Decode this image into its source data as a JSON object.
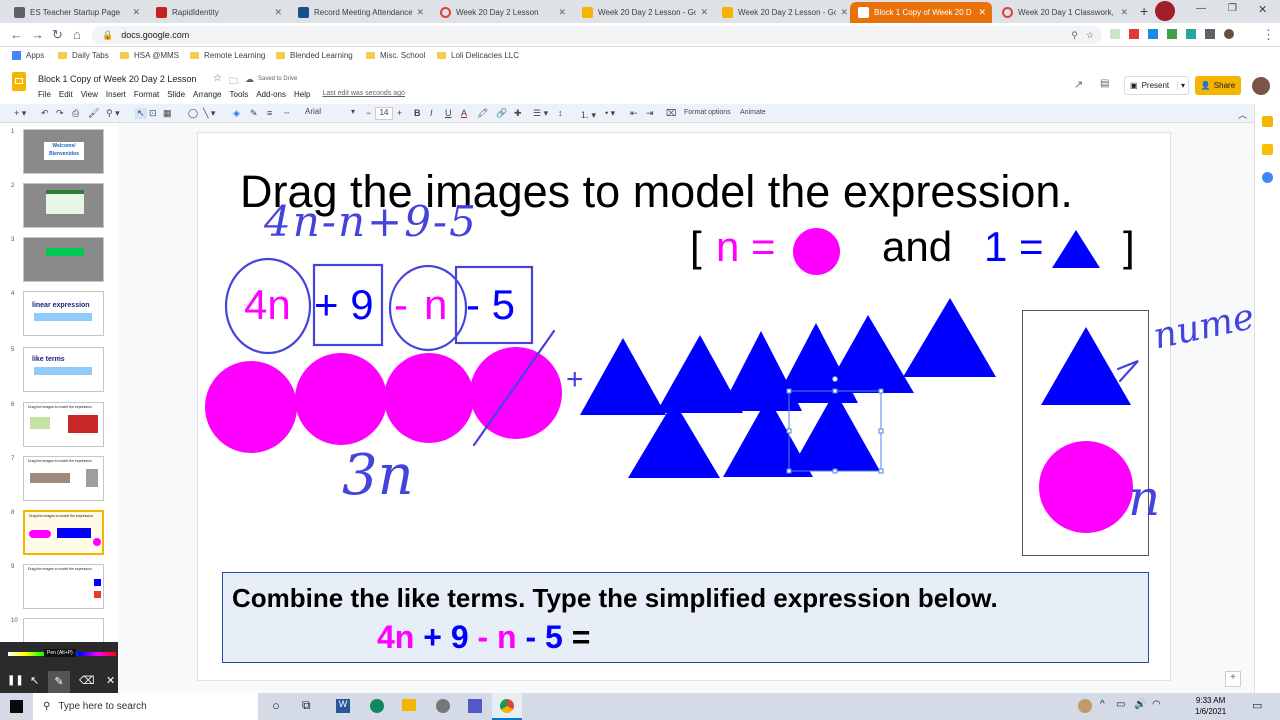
{
  "tabs": [
    {
      "label": "ES Teacher Startup Page",
      "color": "#5f6368"
    },
    {
      "label": "RapidIdentity",
      "color": "#c5221f"
    },
    {
      "label": "Record Meeting Attendance",
      "color": "#1a4f8b"
    },
    {
      "label": "Week 20 Day 2 Lesson",
      "color": "#db4437"
    },
    {
      "label": "Week 20 Day 2 Lesson - Go",
      "color": "#f4b400"
    },
    {
      "label": "Week 20 Day 2 Lesson - Go",
      "color": "#f4b400"
    },
    {
      "label": "Block 1 Copy of Week 20 D",
      "color": "#fff"
    },
    {
      "label": "Week 20 Day 1 Classwork, S",
      "color": "#db4437"
    }
  ],
  "address": {
    "url": "docs.google.com"
  },
  "bookmarks": [
    "Apps",
    "Daily Tabs",
    "HSA @MMS",
    "Remote Learning",
    "Blended Learning",
    "Misc. School",
    "Loli Delicacies LLC"
  ],
  "doc": {
    "title": "Block 1 Copy of Week 20 Day 2 Lesson",
    "saved": "Saved to Drive",
    "last_edit": "Last edit was seconds ago",
    "present": "Present",
    "share": "Share"
  },
  "menu": [
    "File",
    "Edit",
    "View",
    "Insert",
    "Format",
    "Slide",
    "Arrange",
    "Tools",
    "Add-ons",
    "Help"
  ],
  "toolbar": {
    "font": "Arial",
    "size": "14",
    "format_options": "Format options",
    "animate": "Animate"
  },
  "slides": [
    "1",
    "2",
    "3",
    "4",
    "5",
    "6",
    "7",
    "8",
    "9",
    "10"
  ],
  "thumbs": {
    "welcome": "Welcome/ Bienvenidos",
    "linear": "linear expression",
    "like": "like terms",
    "drag": "Drag the images to model the expression"
  },
  "slide": {
    "title": "Drag the images to model the expression.",
    "legend_open": "[",
    "legend_n": "n =",
    "legend_and": "and",
    "legend_1": "1 =",
    "legend_close": "]",
    "expr_4n": "4n",
    "expr_plus": "+ 9",
    "expr_minus": "-",
    "expr_n": "n",
    "expr_5": "- 5",
    "hand_expr": "4n-n+9-5",
    "hand_3n": "3n",
    "hand_plus": "+",
    "hand_numer": "numer",
    "hand_n": "n",
    "box_title": "Combine the like terms. Type the simplified expression below.",
    "box_expr_4n": "4n",
    "box_expr_p9": "+ 9",
    "box_expr_m": "-",
    "box_expr_n": "n",
    "box_expr_m5": "- 5",
    "box_expr_eq": "="
  },
  "colors": {
    "magenta": "#ff00ff",
    "blue": "#0000ff",
    "ink": "#4444dd"
  },
  "pen": {
    "label": "Pen (Alt+P)"
  },
  "taskbar": {
    "search": "Type here to search",
    "time": "9:33 AM",
    "date": "1/6/2021"
  }
}
